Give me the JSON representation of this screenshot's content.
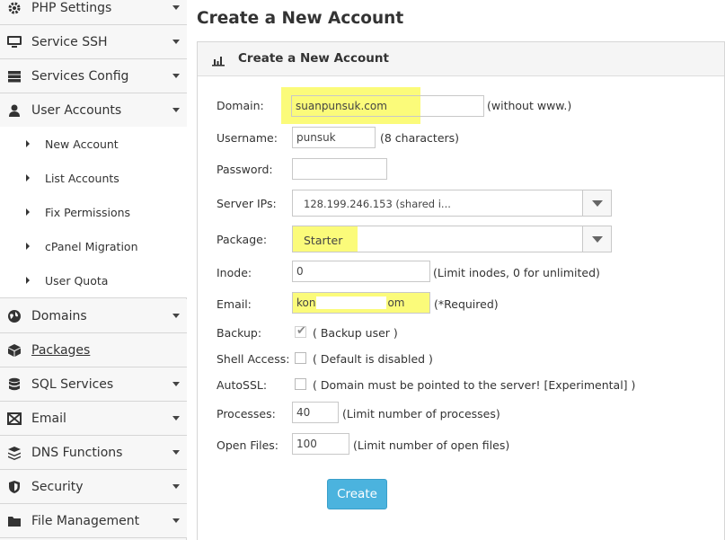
{
  "sidebar": {
    "items": [
      {
        "label": "PHP Settings",
        "icon": "gear-icon"
      },
      {
        "label": "Service SSH",
        "icon": "monitor-icon"
      },
      {
        "label": "Services Config",
        "icon": "server-icon"
      },
      {
        "label": "User Accounts",
        "icon": "user-icon"
      },
      {
        "label": "Domains",
        "icon": "globe-icon"
      },
      {
        "label": "Packages",
        "icon": "box-icon"
      },
      {
        "label": "SQL Services",
        "icon": "database-icon"
      },
      {
        "label": "Email",
        "icon": "envelope-icon"
      },
      {
        "label": "DNS Functions",
        "icon": "dns-icon"
      },
      {
        "label": "Security",
        "icon": "shield-icon"
      },
      {
        "label": "File Management",
        "icon": "folder-icon"
      }
    ],
    "submenu": [
      "New Account",
      "List Accounts",
      "Fix Permissions",
      "cPanel Migration",
      "User Quota"
    ]
  },
  "page": {
    "title": "Create a New Account"
  },
  "panel": {
    "title": "Create a New Account",
    "icon": "bar-chart-icon"
  },
  "form": {
    "domain": {
      "label": "Domain:",
      "value": "suanpunsuk.com",
      "note": "(without www.)"
    },
    "username": {
      "label": "Username:",
      "value": "punsuk",
      "note": "(8 characters)"
    },
    "password": {
      "label": "Password:",
      "value": ""
    },
    "server_ips": {
      "label": "Server IPs:",
      "value": "128.199.246.153 (shared i..."
    },
    "package": {
      "label": "Package:",
      "value": "Starter"
    },
    "inode": {
      "label": "Inode:",
      "value": "0",
      "note": "(Limit inodes, 0 for unlimited)"
    },
    "email": {
      "label": "Email:",
      "value_start": "kon",
      "value_end": "om",
      "note": "(*Required)"
    },
    "backup": {
      "label": "Backup:",
      "note": "( Backup user )",
      "checked": true
    },
    "shell": {
      "label": "Shell Access:",
      "note": "( Default is disabled )",
      "checked": false
    },
    "autossl": {
      "label": "AutoSSL:",
      "note": "( Domain must be pointed to the server! [Experimental] )",
      "checked": false
    },
    "processes": {
      "label": "Processes:",
      "value": "40",
      "note": "(Limit number of processes)"
    },
    "open_files": {
      "label": "Open Files:",
      "value": "100",
      "note": "(Limit number of open files)"
    },
    "create_label": "Create"
  },
  "colors": {
    "highlight": "#fbfb7a",
    "button": "#4bb3de"
  }
}
